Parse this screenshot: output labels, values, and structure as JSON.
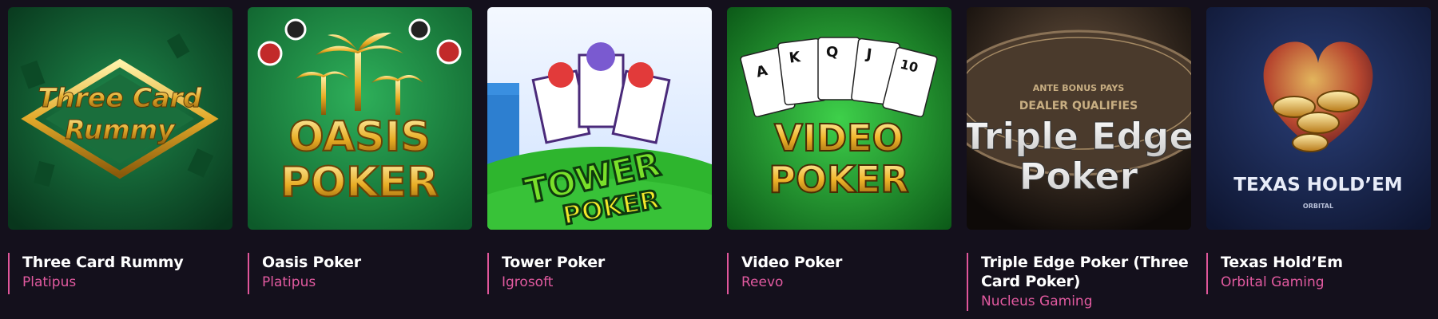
{
  "games": [
    {
      "art": "three-card-rummy-art",
      "art_text": [
        "Three Card",
        "Rummy"
      ],
      "title": "Three Card Rummy",
      "provider": "Platipus"
    },
    {
      "art": "oasis-poker-art",
      "art_text": [
        "OASIS",
        "POKER"
      ],
      "title": "Oasis Poker",
      "provider": "Platipus"
    },
    {
      "art": "tower-poker-art",
      "art_text": [
        "TOWER",
        "POKER"
      ],
      "title": "Tower Poker",
      "provider": "Igrosoft"
    },
    {
      "art": "video-poker-art",
      "art_text": [
        "VIDEO",
        "POKER"
      ],
      "cards": [
        "A",
        "K",
        "Q",
        "J",
        "10"
      ],
      "title": "Video Poker",
      "provider": "Reevo"
    },
    {
      "art": "triple-edge-poker-art",
      "art_text": [
        "Triple Edge",
        "Poker"
      ],
      "table_text": [
        "ANTE BONUS PAYS",
        "DEALER QUALIFIES"
      ],
      "title": "Triple Edge Poker (Three Card Poker)",
      "provider": "Nucleus Gaming"
    },
    {
      "art": "texas-holdem-art",
      "art_text": [
        "TEXAS HOLD’EM",
        "ORBITAL"
      ],
      "title": "Texas Hold’Em",
      "provider": "Orbital Gaming"
    }
  ],
  "colors": {
    "background": "#14101c",
    "accent": "#e25aa0",
    "title": "#ffffff"
  }
}
